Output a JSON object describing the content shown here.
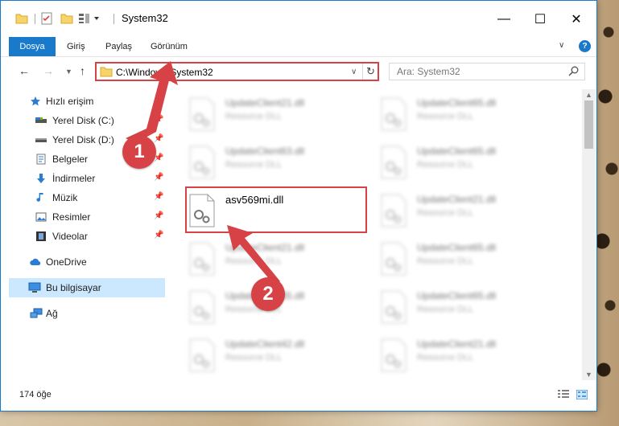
{
  "window": {
    "title": "System32",
    "controls": {
      "minimize": "—",
      "maximize": "☐",
      "close": "✕"
    }
  },
  "ribbon": {
    "tabs": [
      {
        "label": "Dosya",
        "active": true
      },
      {
        "label": "Giriş"
      },
      {
        "label": "Paylaş"
      },
      {
        "label": "Görünüm"
      }
    ],
    "help": "?"
  },
  "navigation": {
    "address": "C:\\Windows\\System32",
    "search_placeholder": "Ara: System32"
  },
  "sidebar": {
    "items": [
      {
        "label": "Hızlı erişim",
        "icon": "star-icon"
      },
      {
        "label": "Yerel Disk (C:)",
        "icon": "drive-icon",
        "pinned": true
      },
      {
        "label": "Yerel Disk (D:)",
        "icon": "drive-icon",
        "pinned": true
      },
      {
        "label": "Belgeler",
        "icon": "documents-icon",
        "pinned": true
      },
      {
        "label": "İndirmeler",
        "icon": "download-icon",
        "pinned": true
      },
      {
        "label": "Müzik",
        "icon": "music-icon",
        "pinned": true
      },
      {
        "label": "Resimler",
        "icon": "pictures-icon",
        "pinned": true
      },
      {
        "label": "Videolar",
        "icon": "videos-icon",
        "pinned": true
      },
      {
        "label": "OneDrive",
        "icon": "onedrive-icon"
      },
      {
        "label": "Bu bilgisayar",
        "icon": "computer-icon",
        "selected": true
      },
      {
        "label": "Ağ",
        "icon": "network-icon"
      }
    ]
  },
  "files": [
    {
      "name": "UpdateClient21.dll",
      "type": "Resource DLL",
      "blurred": true
    },
    {
      "name": "UpdateClient65.dll",
      "type": "Resource DLL",
      "blurred": true
    },
    {
      "name": "UpdateClient63.dll",
      "type": "Resource DLL",
      "blurred": true
    },
    {
      "name": "UpdateClient65.dll",
      "type": "Resource DLL",
      "blurred": true
    },
    {
      "name": "asv569mi.dll",
      "type": "",
      "blurred": false,
      "highlighted": true
    },
    {
      "name": "UpdateClient21.dll",
      "type": "Resource DLL",
      "blurred": true
    },
    {
      "name": "UpdateClient21.dll",
      "type": "Resource DLL",
      "blurred": true
    },
    {
      "name": "UpdateClient65.dll",
      "type": "Resource DLL",
      "blurred": true
    },
    {
      "name": "UpdateClient65.dll",
      "type": "Resource DLL",
      "blurred": true
    },
    {
      "name": "UpdateClient65.dll",
      "type": "Resource DLL",
      "blurred": true
    },
    {
      "name": "UpdateClient42.dll",
      "type": "Resource DLL",
      "blurred": true
    },
    {
      "name": "UpdateClient21.dll",
      "type": "Resource DLL",
      "blurred": true
    }
  ],
  "status": {
    "item_count": "174 öğe"
  },
  "callouts": {
    "one": "1",
    "two": "2"
  },
  "colors": {
    "accent": "#1979ca",
    "highlight": "#d64245",
    "selected": "#cce8ff"
  }
}
